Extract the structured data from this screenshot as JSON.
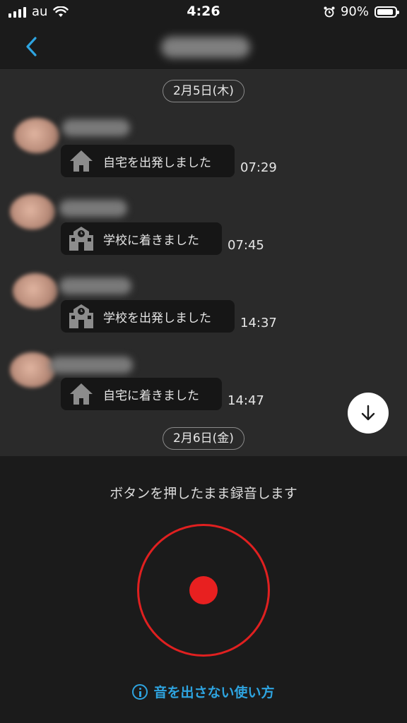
{
  "status_bar": {
    "carrier": "au",
    "time": "4:26",
    "battery": "90%",
    "battery_level": 0.9
  },
  "header": {
    "back_icon": "chevron-left-icon"
  },
  "chat": {
    "dates": [
      "2月5日(木)",
      "2月6日(金)"
    ],
    "messages": [
      {
        "icon": "home-icon",
        "text": "自宅を出発しました",
        "time": "07:29"
      },
      {
        "icon": "school-icon",
        "text": "学校に着きました",
        "time": "07:45"
      },
      {
        "icon": "school-icon",
        "text": "学校を出発しました",
        "time": "14:37"
      },
      {
        "icon": "home-icon",
        "text": "自宅に着きました",
        "time": "14:47"
      }
    ],
    "scroll_icon": "arrow-down-icon"
  },
  "recorder": {
    "hint": "ボタンを押したまま録音します",
    "howto": "音を出さない使い方",
    "accent_color": "#e02020",
    "link_color": "#2ea4e0"
  }
}
